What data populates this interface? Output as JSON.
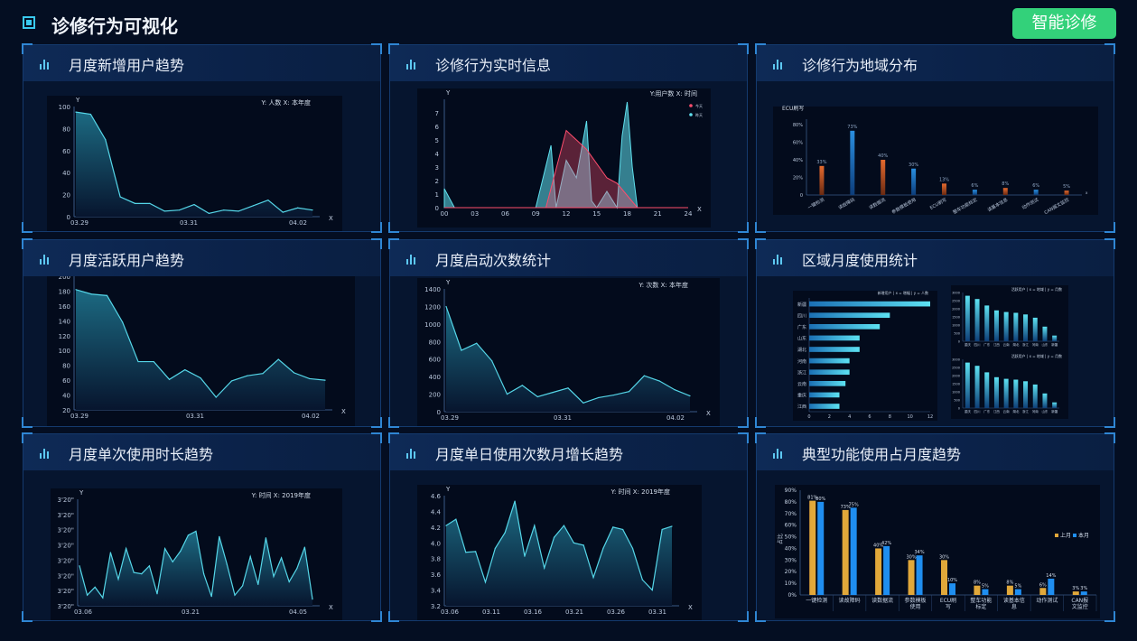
{
  "header": {
    "title": "诊修行为可视化",
    "button": "智能诊修"
  },
  "panels": [
    {
      "title": "月度新增用户趋势"
    },
    {
      "title": "诊修行为实时信息"
    },
    {
      "title": "诊修行为地域分布"
    },
    {
      "title": "月度活跃用户趋势"
    },
    {
      "title": "月度启动次数统计"
    },
    {
      "title": "区域月度使用统计"
    },
    {
      "title": "月度单次使用时长趋势"
    },
    {
      "title": "月度单日使用次数月增长趋势"
    },
    {
      "title": "典型功能使用占月度趋势"
    }
  ],
  "colors": {
    "line": "#55d6e8",
    "area_top": "#1c6a82",
    "area_bottom": "#07152e",
    "accent": "#39c9ef",
    "button": "#33d17a"
  },
  "chart_data": [
    {
      "type": "area",
      "legend_text": "Y: 人数   X: 本年度",
      "xlabel": "X",
      "ylabel": "Y",
      "ylim": [
        0,
        100
      ],
      "yticks": [
        0,
        20,
        40,
        60,
        80,
        100
      ],
      "xticklabels": [
        "03.29",
        "03.31",
        "04.02"
      ],
      "values": [
        95,
        93,
        70,
        18,
        12,
        12,
        5,
        6,
        11,
        3,
        6,
        5,
        10,
        15,
        4,
        8,
        6
      ]
    },
    {
      "type": "line",
      "legend_text": "Y:用户数   X: 时间",
      "legend": [
        "今天",
        "昨天"
      ],
      "xlabel": "X",
      "ylabel": "Y",
      "ylim": [
        0,
        8
      ],
      "yticks": [
        0,
        1,
        2,
        3,
        4,
        5,
        6,
        7
      ],
      "xticklabels": [
        "00",
        "03",
        "06",
        "09",
        "12",
        "15",
        "18",
        "21",
        "24"
      ],
      "series": [
        {
          "name": "今天",
          "x": [
            0,
            10,
            12,
            14,
            16,
            17,
            19,
            24
          ],
          "values": [
            0,
            0,
            5.7,
            4.3,
            2.2,
            1.8,
            0,
            0
          ]
        },
        {
          "name": "昨天",
          "x": [
            0,
            1,
            9,
            10.5,
            11,
            12,
            13,
            14,
            14.5,
            15,
            16,
            17,
            17.5,
            18,
            18.5,
            19,
            24
          ],
          "values": [
            1.4,
            0,
            0,
            4.6,
            0,
            3.5,
            2.2,
            6.4,
            0.5,
            0,
            1.2,
            0,
            5.3,
            7.8,
            3,
            0,
            0
          ]
        }
      ]
    },
    {
      "type": "bar",
      "legend_text": "ECU刷写",
      "ylim": [
        0,
        80
      ],
      "yticks": [
        "0",
        "20%",
        "40%",
        "60%",
        "80%"
      ],
      "categories": [
        "一键检测",
        "读故障码",
        "读数据流",
        "参数模板使用",
        "ECU刷写",
        "整车功能标定",
        "读基本信息",
        "动作测试",
        "CAN报文监控"
      ],
      "values": [
        33,
        73,
        40,
        30,
        13,
        6,
        8,
        6,
        5
      ],
      "labels": [
        "33%",
        "73%",
        "40%",
        "30%",
        "13%",
        "6%",
        "8%",
        "6%",
        "5%"
      ]
    },
    {
      "type": "area",
      "legend_text": "Y: 人数   X: 本年度",
      "xlabel": "X",
      "ylabel": "Y",
      "ylim": [
        20,
        200
      ],
      "yticks": [
        20,
        40,
        60,
        80,
        100,
        120,
        140,
        160,
        180,
        200
      ],
      "xticklabels": [
        "03.29",
        "03.31",
        "04.02"
      ],
      "values": [
        182,
        176,
        174,
        138,
        85,
        85,
        61,
        74,
        63,
        37,
        59,
        66,
        69,
        88,
        70,
        62,
        60
      ]
    },
    {
      "type": "area",
      "legend_text": "Y: 次数   X: 本年度",
      "xlabel": "X",
      "ylabel": "Y",
      "ylim": [
        0,
        1400
      ],
      "yticks": [
        0,
        200,
        400,
        600,
        800,
        1000,
        1200,
        1400
      ],
      "xticklabels": [
        "03.29",
        "03.31",
        "04.02"
      ],
      "values": [
        1200,
        700,
        780,
        580,
        200,
        300,
        170,
        220,
        270,
        100,
        160,
        190,
        230,
        410,
        350,
        250,
        180
      ]
    },
    {
      "type": "bar",
      "sub": [
        {
          "orientation": "horizontal",
          "legend_text": "新增用户   |   x = 增幅   |   y = 人数",
          "categories": [
            "新疆",
            "四川",
            "广东",
            "山东",
            "湖北",
            "河南",
            "浙江",
            "云南",
            "重庆",
            "江西"
          ],
          "values": [
            12,
            8,
            7,
            5,
            5,
            4,
            4,
            3.6,
            3,
            3
          ],
          "xticks": [
            "0",
            "2",
            "4",
            "6",
            "8",
            "10",
            "12"
          ],
          "xlim": [
            0,
            12
          ]
        },
        {
          "orientation": "vertical",
          "legend_text": "活跃用户   |   x = 地域   |   y = 月数",
          "categories": [
            "重庆",
            "四川",
            "广东",
            "江西",
            "云南",
            "湖北",
            "浙江",
            "河南",
            "山东",
            "新疆"
          ],
          "values": [
            2800,
            2600,
            2200,
            1900,
            1800,
            1750,
            1650,
            1450,
            900,
            350
          ],
          "yticks": [
            "0",
            "500",
            "1000",
            "1500",
            "2000",
            "2500",
            "3000"
          ],
          "ylim": [
            0,
            3000
          ]
        },
        {
          "orientation": "vertical",
          "legend_text": "活跃用户   |   x = 地域   |   y = 月数",
          "categories": [
            "重庆",
            "四川",
            "广东",
            "江西",
            "云南",
            "湖北",
            "浙江",
            "河南",
            "山东",
            "新疆"
          ],
          "values": [
            2800,
            2600,
            2200,
            1900,
            1800,
            1750,
            1650,
            1450,
            900,
            350
          ],
          "yticks": [
            "0",
            "500",
            "1000",
            "1500",
            "2000",
            "2500",
            "3000"
          ],
          "ylim": [
            0,
            3000
          ]
        }
      ]
    },
    {
      "type": "area",
      "legend_text": "Y: 时间   X: 2019年度",
      "xlabel": "X",
      "ylabel": "Y",
      "ylim": [
        0,
        8
      ],
      "yticks": [
        "3'20\"",
        "3'20\"",
        "3'20\"",
        "3'20\"",
        "3'20\"",
        "3'20\"",
        "3'20\"",
        "3'20\""
      ],
      "xticklabels": [
        "03.06",
        "03.21",
        "04.05"
      ],
      "values": [
        3,
        0.8,
        1.4,
        0.6,
        4,
        2,
        4.3,
        2.5,
        2.4,
        3,
        0.9,
        4.3,
        3.3,
        4.1,
        5.3,
        5.6,
        2.4,
        0.7,
        5.2,
        3.1,
        0.8,
        1.5,
        3.7,
        1.6,
        5.1,
        2.2,
        3.6,
        1.8,
        2.8,
        4.4,
        0.5
      ],
      "ymin_zero": true
    },
    {
      "type": "area",
      "legend_text": "Y: 时间   X: 2019年度",
      "xlabel": "X",
      "ylabel": "Y",
      "ylim": [
        3.2,
        4.6
      ],
      "yticks": [
        "3.2",
        "3.4",
        "3.6",
        "3.8",
        "4.0",
        "4.2",
        "4.4",
        "4.6"
      ],
      "xticklabels": [
        "03.06",
        "03.11",
        "03.16",
        "03.21",
        "03.26",
        "03.31"
      ],
      "values": [
        4.22,
        4.3,
        3.88,
        3.89,
        3.5,
        3.93,
        4.13,
        4.53,
        3.83,
        4.22,
        3.68,
        4.07,
        4.22,
        4.0,
        3.97,
        3.56,
        3.93,
        4.2,
        4.17,
        3.93,
        3.53,
        3.4,
        4.17,
        4.21
      ]
    },
    {
      "type": "bar",
      "ylabel": "占比",
      "ylim": [
        0,
        90
      ],
      "yticks": [
        "0%",
        "10%",
        "20%",
        "30%",
        "40%",
        "50%",
        "60%",
        "70%",
        "80%",
        "90%"
      ],
      "categories": [
        "一键检测",
        "读故障码",
        "读数据流",
        "参数模板使用",
        "ECU刷写",
        "整车功能标定",
        "读基本信息",
        "动作测试",
        "CAN报文监控"
      ],
      "series": [
        {
          "name": "上月",
          "values": [
            81,
            73,
            40,
            30,
            30,
            8,
            8,
            6,
            3
          ],
          "labels": [
            "81%",
            "73%",
            "40%",
            "30%",
            "30%",
            "8%",
            "8%",
            "6%",
            "3%"
          ]
        },
        {
          "name": "本月",
          "values": [
            80,
            75,
            42,
            34,
            10,
            5,
            5,
            14,
            3
          ],
          "labels": [
            "80%",
            "75%",
            "42%",
            "34%",
            "10%",
            "5%",
            "5%",
            "14%",
            "3%"
          ]
        }
      ]
    }
  ]
}
